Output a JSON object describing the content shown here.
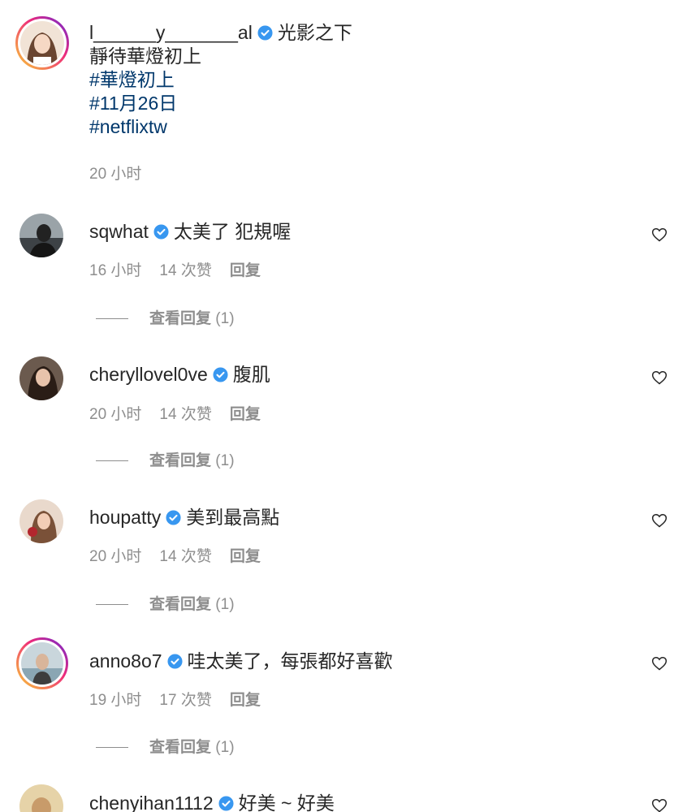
{
  "post": {
    "username": "l______y_______al",
    "caption_first": "光影之下",
    "caption_second": "靜待華燈初上",
    "hashtags": [
      "#華燈初上",
      "#11月26日",
      "#netflixtw"
    ],
    "time": "20 小时"
  },
  "comments": [
    {
      "username": "sqwhat",
      "text": "太美了 犯規喔",
      "time": "16 小时",
      "likes": "14 次赞",
      "reply": "回复",
      "view_replies": "查看回复",
      "reply_count": "(1)"
    },
    {
      "username": "cheryllovel0ve",
      "text": "腹肌",
      "time": "20 小时",
      "likes": "14 次赞",
      "reply": "回复",
      "view_replies": "查看回复",
      "reply_count": "(1)"
    },
    {
      "username": "houpatty",
      "text": "美到最高點",
      "time": "20 小时",
      "likes": "14 次赞",
      "reply": "回复",
      "view_replies": "查看回复",
      "reply_count": "(1)"
    },
    {
      "username": "anno8o7",
      "text": "哇太美了，每張都好喜歡",
      "time": "19 小时",
      "likes": "17 次赞",
      "reply": "回复",
      "view_replies": "查看回复",
      "reply_count": "(1)"
    },
    {
      "username": "chenyihan1112",
      "text": "好美 ~ 好美"
    }
  ],
  "colors": {
    "verified": "#3897f0",
    "hashtag": "#00376b",
    "meta": "#8e8e8e"
  }
}
